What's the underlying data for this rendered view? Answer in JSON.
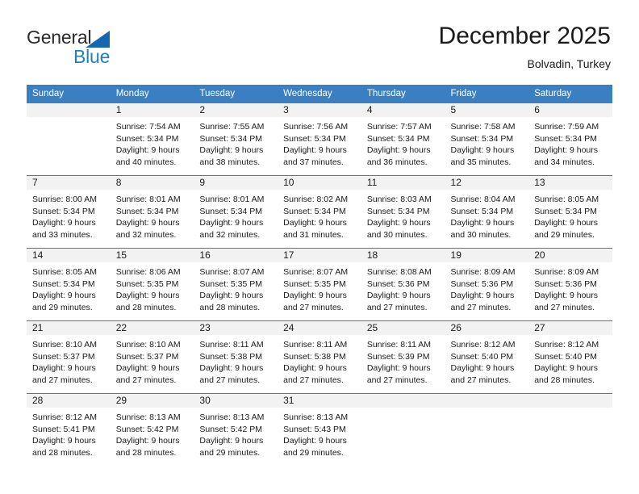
{
  "brand": {
    "name_part1": "General",
    "name_part2": "Blue",
    "triangle_icon": "triangle-icon"
  },
  "header": {
    "title": "December 2025",
    "location": "Bolvadin, Turkey"
  },
  "colors": {
    "header_blue": "#3a7fc1",
    "brand_blue": "#1f7fcc",
    "daynum_bg": "#f2f2f2"
  },
  "weekdays": [
    "Sunday",
    "Monday",
    "Tuesday",
    "Wednesday",
    "Thursday",
    "Friday",
    "Saturday"
  ],
  "weeks": [
    [
      {
        "day": "",
        "sunrise": "",
        "sunset": "",
        "daylight_line1": "",
        "daylight_line2": "",
        "empty": true
      },
      {
        "day": "1",
        "sunrise": "Sunrise: 7:54 AM",
        "sunset": "Sunset: 5:34 PM",
        "daylight_line1": "Daylight: 9 hours",
        "daylight_line2": "and 40 minutes."
      },
      {
        "day": "2",
        "sunrise": "Sunrise: 7:55 AM",
        "sunset": "Sunset: 5:34 PM",
        "daylight_line1": "Daylight: 9 hours",
        "daylight_line2": "and 38 minutes."
      },
      {
        "day": "3",
        "sunrise": "Sunrise: 7:56 AM",
        "sunset": "Sunset: 5:34 PM",
        "daylight_line1": "Daylight: 9 hours",
        "daylight_line2": "and 37 minutes."
      },
      {
        "day": "4",
        "sunrise": "Sunrise: 7:57 AM",
        "sunset": "Sunset: 5:34 PM",
        "daylight_line1": "Daylight: 9 hours",
        "daylight_line2": "and 36 minutes."
      },
      {
        "day": "5",
        "sunrise": "Sunrise: 7:58 AM",
        "sunset": "Sunset: 5:34 PM",
        "daylight_line1": "Daylight: 9 hours",
        "daylight_line2": "and 35 minutes."
      },
      {
        "day": "6",
        "sunrise": "Sunrise: 7:59 AM",
        "sunset": "Sunset: 5:34 PM",
        "daylight_line1": "Daylight: 9 hours",
        "daylight_line2": "and 34 minutes."
      }
    ],
    [
      {
        "day": "7",
        "sunrise": "Sunrise: 8:00 AM",
        "sunset": "Sunset: 5:34 PM",
        "daylight_line1": "Daylight: 9 hours",
        "daylight_line2": "and 33 minutes."
      },
      {
        "day": "8",
        "sunrise": "Sunrise: 8:01 AM",
        "sunset": "Sunset: 5:34 PM",
        "daylight_line1": "Daylight: 9 hours",
        "daylight_line2": "and 32 minutes."
      },
      {
        "day": "9",
        "sunrise": "Sunrise: 8:01 AM",
        "sunset": "Sunset: 5:34 PM",
        "daylight_line1": "Daylight: 9 hours",
        "daylight_line2": "and 32 minutes."
      },
      {
        "day": "10",
        "sunrise": "Sunrise: 8:02 AM",
        "sunset": "Sunset: 5:34 PM",
        "daylight_line1": "Daylight: 9 hours",
        "daylight_line2": "and 31 minutes."
      },
      {
        "day": "11",
        "sunrise": "Sunrise: 8:03 AM",
        "sunset": "Sunset: 5:34 PM",
        "daylight_line1": "Daylight: 9 hours",
        "daylight_line2": "and 30 minutes."
      },
      {
        "day": "12",
        "sunrise": "Sunrise: 8:04 AM",
        "sunset": "Sunset: 5:34 PM",
        "daylight_line1": "Daylight: 9 hours",
        "daylight_line2": "and 30 minutes."
      },
      {
        "day": "13",
        "sunrise": "Sunrise: 8:05 AM",
        "sunset": "Sunset: 5:34 PM",
        "daylight_line1": "Daylight: 9 hours",
        "daylight_line2": "and 29 minutes."
      }
    ],
    [
      {
        "day": "14",
        "sunrise": "Sunrise: 8:05 AM",
        "sunset": "Sunset: 5:34 PM",
        "daylight_line1": "Daylight: 9 hours",
        "daylight_line2": "and 29 minutes."
      },
      {
        "day": "15",
        "sunrise": "Sunrise: 8:06 AM",
        "sunset": "Sunset: 5:35 PM",
        "daylight_line1": "Daylight: 9 hours",
        "daylight_line2": "and 28 minutes."
      },
      {
        "day": "16",
        "sunrise": "Sunrise: 8:07 AM",
        "sunset": "Sunset: 5:35 PM",
        "daylight_line1": "Daylight: 9 hours",
        "daylight_line2": "and 28 minutes."
      },
      {
        "day": "17",
        "sunrise": "Sunrise: 8:07 AM",
        "sunset": "Sunset: 5:35 PM",
        "daylight_line1": "Daylight: 9 hours",
        "daylight_line2": "and 27 minutes."
      },
      {
        "day": "18",
        "sunrise": "Sunrise: 8:08 AM",
        "sunset": "Sunset: 5:36 PM",
        "daylight_line1": "Daylight: 9 hours",
        "daylight_line2": "and 27 minutes."
      },
      {
        "day": "19",
        "sunrise": "Sunrise: 8:09 AM",
        "sunset": "Sunset: 5:36 PM",
        "daylight_line1": "Daylight: 9 hours",
        "daylight_line2": "and 27 minutes."
      },
      {
        "day": "20",
        "sunrise": "Sunrise: 8:09 AM",
        "sunset": "Sunset: 5:36 PM",
        "daylight_line1": "Daylight: 9 hours",
        "daylight_line2": "and 27 minutes."
      }
    ],
    [
      {
        "day": "21",
        "sunrise": "Sunrise: 8:10 AM",
        "sunset": "Sunset: 5:37 PM",
        "daylight_line1": "Daylight: 9 hours",
        "daylight_line2": "and 27 minutes."
      },
      {
        "day": "22",
        "sunrise": "Sunrise: 8:10 AM",
        "sunset": "Sunset: 5:37 PM",
        "daylight_line1": "Daylight: 9 hours",
        "daylight_line2": "and 27 minutes."
      },
      {
        "day": "23",
        "sunrise": "Sunrise: 8:11 AM",
        "sunset": "Sunset: 5:38 PM",
        "daylight_line1": "Daylight: 9 hours",
        "daylight_line2": "and 27 minutes."
      },
      {
        "day": "24",
        "sunrise": "Sunrise: 8:11 AM",
        "sunset": "Sunset: 5:38 PM",
        "daylight_line1": "Daylight: 9 hours",
        "daylight_line2": "and 27 minutes."
      },
      {
        "day": "25",
        "sunrise": "Sunrise: 8:11 AM",
        "sunset": "Sunset: 5:39 PM",
        "daylight_line1": "Daylight: 9 hours",
        "daylight_line2": "and 27 minutes."
      },
      {
        "day": "26",
        "sunrise": "Sunrise: 8:12 AM",
        "sunset": "Sunset: 5:40 PM",
        "daylight_line1": "Daylight: 9 hours",
        "daylight_line2": "and 27 minutes."
      },
      {
        "day": "27",
        "sunrise": "Sunrise: 8:12 AM",
        "sunset": "Sunset: 5:40 PM",
        "daylight_line1": "Daylight: 9 hours",
        "daylight_line2": "and 28 minutes."
      }
    ],
    [
      {
        "day": "28",
        "sunrise": "Sunrise: 8:12 AM",
        "sunset": "Sunset: 5:41 PM",
        "daylight_line1": "Daylight: 9 hours",
        "daylight_line2": "and 28 minutes."
      },
      {
        "day": "29",
        "sunrise": "Sunrise: 8:13 AM",
        "sunset": "Sunset: 5:42 PM",
        "daylight_line1": "Daylight: 9 hours",
        "daylight_line2": "and 28 minutes."
      },
      {
        "day": "30",
        "sunrise": "Sunrise: 8:13 AM",
        "sunset": "Sunset: 5:42 PM",
        "daylight_line1": "Daylight: 9 hours",
        "daylight_line2": "and 29 minutes."
      },
      {
        "day": "31",
        "sunrise": "Sunrise: 8:13 AM",
        "sunset": "Sunset: 5:43 PM",
        "daylight_line1": "Daylight: 9 hours",
        "daylight_line2": "and 29 minutes."
      },
      {
        "day": "",
        "sunrise": "",
        "sunset": "",
        "daylight_line1": "",
        "daylight_line2": "",
        "empty": true
      },
      {
        "day": "",
        "sunrise": "",
        "sunset": "",
        "daylight_line1": "",
        "daylight_line2": "",
        "empty": true
      },
      {
        "day": "",
        "sunrise": "",
        "sunset": "",
        "daylight_line1": "",
        "daylight_line2": "",
        "empty": true
      }
    ]
  ]
}
